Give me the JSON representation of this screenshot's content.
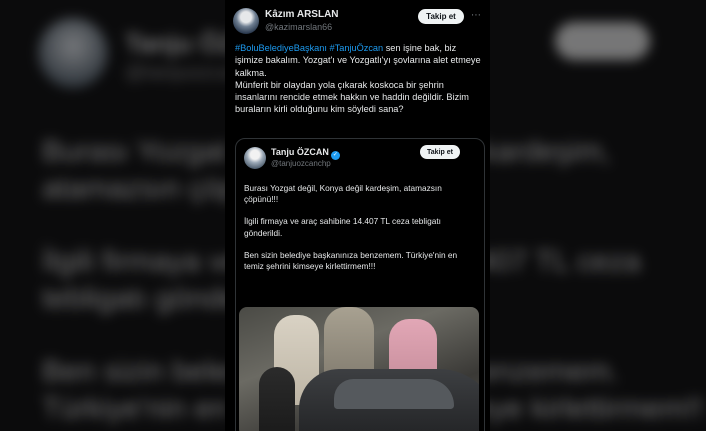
{
  "background": {
    "name": "Tanju ÖZCAN",
    "handle": "@tanjuozcanchp",
    "follow_label": "Takip et",
    "lines": [
      "Burası Yozgat değil, Konya değil kardeşim,",
      "atamazsın çöpünü!!!",
      "İlgili firmaya ve araç sahibine 14.407 TL ceza",
      "tebligatı gönderildi.",
      "Ben sizin belediye başkanınıza benzemem.",
      "Türkiye'nin en temiz şehrini kimseye kirlettirmem!!!"
    ]
  },
  "tweet": {
    "author_name": "Kâzım ARSLAN",
    "author_handle": "@kazimarslan66",
    "follow_label": "Takip et",
    "more_icon": "⋯",
    "hashtag1": "#BoluBelediyeBaşkanı",
    "hashtag2": "#TanjuÖzcan",
    "text_after_hashtags": " sen işine bak, biz işimize bakalım. Yozgat'ı ve Yozgatlı'yı şovlarına alet etmeye kalkma.",
    "text_para2": "Münferit bir olaydan yola çıkarak koskoca bir şehrin insanlarını rencide etmek hakkın ve haddin değildir. Bizim buraların kirli olduğunu kim söyledi sana?"
  },
  "quote": {
    "author_name": "Tanju ÖZCAN",
    "verified_icon": "✓",
    "author_handle": "@tanjuozcanchp",
    "follow_label": "Takip et",
    "paragraphs": [
      "Burası Yozgat değil, Konya değil kardeşim, atamazsın çöpünü!!!",
      "İlgili firmaya ve araç sahibine 14.407 TL ceza tebligatı gönderildi.",
      "Ben sizin belediye başkanınıza benzemem. Türkiye'nin en temiz şehrini kimseye kirlettirmem!!!"
    ]
  },
  "colors": {
    "accent": "#1d9bf0",
    "background": "#000000",
    "text": "#e7e9ea",
    "muted": "#71767b"
  }
}
